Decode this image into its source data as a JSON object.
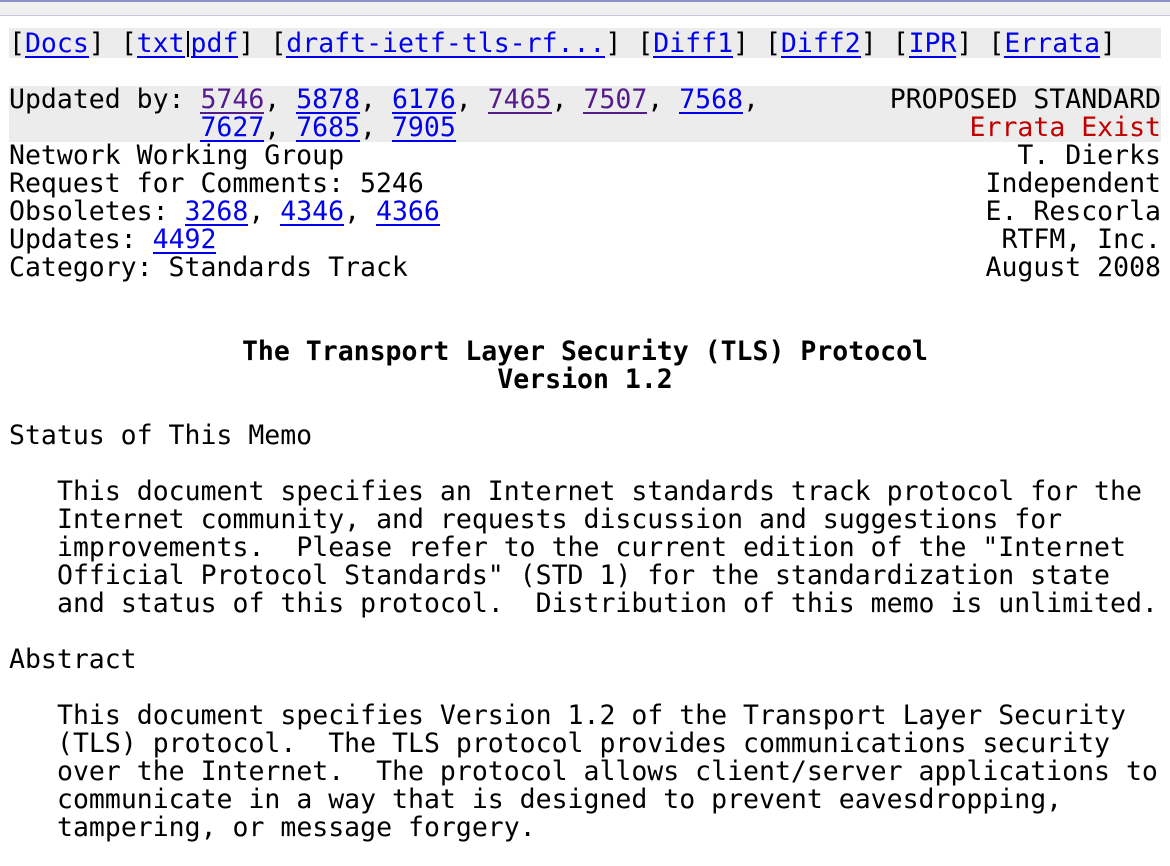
{
  "nav": {
    "docs": "Docs",
    "txt": "txt",
    "pdf": "pdf",
    "draft": "draft-ietf-tls-rf...",
    "diff1": "Diff1",
    "diff2": "Diff2",
    "ipr": "IPR",
    "errata": "Errata"
  },
  "header": {
    "updated_by_label": "Updated by:",
    "updated_by": [
      "5746",
      "5878",
      "6176",
      "7465",
      "7507",
      "7568",
      "7627",
      "7685",
      "7905"
    ],
    "status": "PROPOSED STANDARD",
    "errata_notice": "Errata Exist",
    "group": "Network Working Group",
    "rfc_label": "Request for Comments: 5246",
    "obsoletes_label": "Obsoletes:",
    "obsoletes": [
      "3268",
      "4346",
      "4366"
    ],
    "updates_label": "Updates:",
    "updates": [
      "4492"
    ],
    "category": "Category: Standards Track",
    "author1": "T. Dierks",
    "affil1": "Independent",
    "author2": "E. Rescorla",
    "affil2": "RTFM, Inc.",
    "date": "August 2008"
  },
  "doc": {
    "title": "The Transport Layer Security (TLS) Protocol",
    "version": "Version 1.2",
    "status_heading": "Status of This Memo",
    "status_lines": [
      "This document specifies an Internet standards track protocol for the",
      "Internet community, and requests discussion and suggestions for",
      "improvements.  Please refer to the current edition of the \"Internet",
      "Official Protocol Standards\" (STD 1) for the standardization state",
      "and status of this protocol.  Distribution of this memo is unlimited."
    ],
    "abstract_heading": "Abstract",
    "abstract_lines": [
      "This document specifies Version 1.2 of the Transport Layer Security",
      "(TLS) protocol.  The TLS protocol provides communications security",
      "over the Internet.  The protocol allows client/server applications to",
      "communicate in a way that is designed to prevent eavesdropping,",
      "tampering, or message forgery."
    ]
  },
  "colors": {
    "link": "#0000ee",
    "visited": "#551a8b",
    "errata": "#c00000",
    "header_bg": "#ececec"
  }
}
